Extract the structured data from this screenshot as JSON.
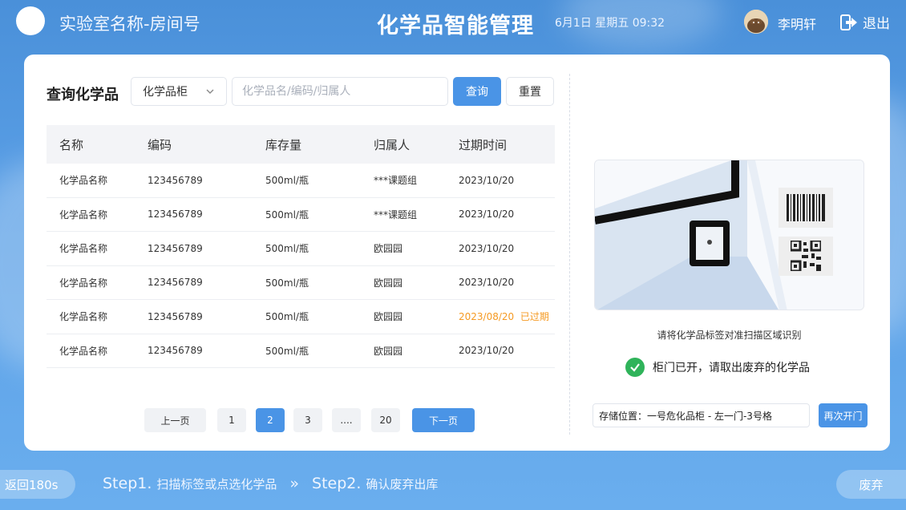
{
  "header": {
    "lab_name": "实验室名称-房间号",
    "app_title": "化学品智能管理",
    "datetime": "6月1日  星期五  09:32",
    "user_name": "李明轩",
    "logout_label": "退出"
  },
  "query": {
    "title": "查询化学品",
    "select_value": "化学品柜",
    "search_placeholder": "化学品名/编码/归属人",
    "query_label": "查询",
    "reset_label": "重置"
  },
  "table": {
    "headers": [
      "名称",
      "编码",
      "库存量",
      "归属人",
      "过期时间"
    ],
    "rows": [
      {
        "name": "化学品名称",
        "code": "123456789",
        "stock": "500ml/瓶",
        "owner": "***课题组",
        "expire": "2023/10/20",
        "expired_tag": ""
      },
      {
        "name": "化学品名称",
        "code": "123456789",
        "stock": "500ml/瓶",
        "owner": "***课题组",
        "expire": "2023/10/20",
        "expired_tag": ""
      },
      {
        "name": "化学品名称",
        "code": "123456789",
        "stock": "500ml/瓶",
        "owner": "欧园园",
        "expire": "2023/10/20",
        "expired_tag": ""
      },
      {
        "name": "化学品名称",
        "code": "123456789",
        "stock": "500ml/瓶",
        "owner": "欧园园",
        "expire": "2023/10/20",
        "expired_tag": ""
      },
      {
        "name": "化学品名称",
        "code": "123456789",
        "stock": "500ml/瓶",
        "owner": "欧园园",
        "expire": "2023/08/20",
        "expired_tag": "已过期"
      },
      {
        "name": "化学品名称",
        "code": "123456789",
        "stock": "500ml/瓶",
        "owner": "欧园园",
        "expire": "2023/10/20",
        "expired_tag": ""
      }
    ]
  },
  "pagination": {
    "prev_label": "上一页",
    "pages": [
      "1",
      "2",
      "3",
      "....",
      "20"
    ],
    "current": "2",
    "next_label": "下一页"
  },
  "scan": {
    "hint": "请将化学品标签对准扫描区域识别",
    "status": "柜门已开，请取出废弃的化学品",
    "storage_label": "存储位置：",
    "storage_value": "一号危化品柜 - 左一门-3号格",
    "reopen_label": "再次开门"
  },
  "footer": {
    "back_label": "返回180s",
    "step1_prefix": "Step1.",
    "step1_text": "扫描标签或点选化学品",
    "separator": "»",
    "step2_prefix": "Step2.",
    "step2_text": "确认废弃出库",
    "discard_label": "废弃"
  },
  "colors": {
    "primary": "#4a94e6",
    "expired": "#f59a23",
    "success": "#2fb35a"
  },
  "icons": {
    "logout": "logout-icon",
    "select": "chevron-down-icon",
    "status": "check-circle-icon",
    "barcode": "barcode-icon",
    "qrcode": "qr-code-icon"
  }
}
